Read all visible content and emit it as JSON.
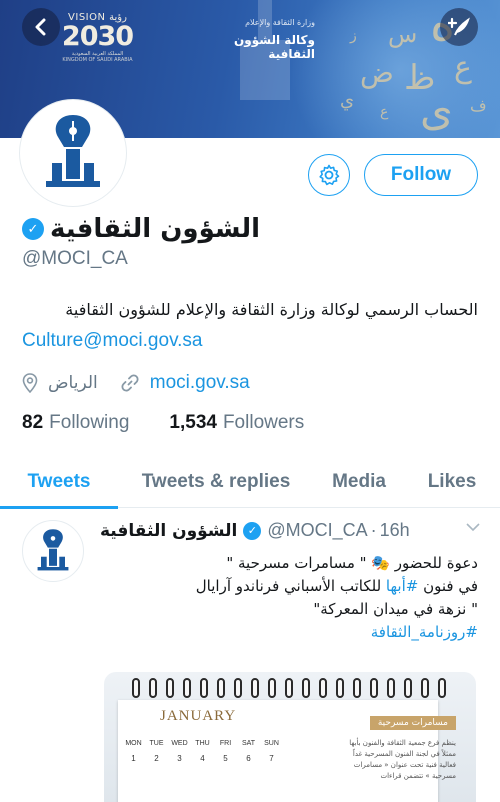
{
  "colors": {
    "accent": "#1da1f2",
    "link": "#1b95e0",
    "muted": "#657786",
    "text": "#14171a"
  },
  "banner": {
    "vision_top": "VISION رؤية",
    "vision_year": "2030",
    "vision_country_ar": "المملكة العربية السعودية",
    "vision_country_en": "KINGDOM OF SAUDI ARABIA",
    "ministry": "وزارة الثقافة والإعلام",
    "agency": "وكالة الشؤون الثقافية",
    "glyphs": [
      "ه",
      "س",
      "ض",
      "ظ",
      "ع",
      "ى",
      "ز",
      "ف",
      "ع",
      "ي"
    ]
  },
  "icons": {
    "back": "chevron-left-icon",
    "compose": "compose-plus-icon",
    "settings": "gear-icon",
    "location": "location-pin-icon",
    "link": "link-icon",
    "verified": "verified-badge-icon"
  },
  "profile": {
    "follow_label": "Follow",
    "display_name": "الشؤون الثقافية",
    "handle": "@MOCI_CA",
    "bio": "الحساب الرسمي لوكالة وزارة الثقافة والإعلام للشؤون الثقافية",
    "bio_email": "Culture@moci.gov.sa",
    "location": "الرياض",
    "website": "moci.gov.sa",
    "following_count": "82",
    "following_label": "Following",
    "followers_count": "1,534",
    "followers_label": "Followers"
  },
  "tabs": [
    {
      "label": "Tweets",
      "active": true
    },
    {
      "label": "Tweets & replies",
      "active": false
    },
    {
      "label": "Media",
      "active": false
    },
    {
      "label": "Likes",
      "active": false
    }
  ],
  "tweet": {
    "name": "الشؤون الثقافية",
    "handle": "@MOCI_CA",
    "separator": "·",
    "time": "16h",
    "line1": "دعوة للحضور 🎭 \" مسامرات مسرحية \"",
    "line2_pre": "في فنون ",
    "line2_tag": "#أبها",
    "line2_post": " للكاتب الأسباني فرناندو آرايال",
    "line3": "\" نزهة في ميدان المعركة\"",
    "line4_tag": "#روزنامة_الثقافة",
    "image": {
      "month": "JANUARY",
      "days": [
        "MON",
        "TUE",
        "WED",
        "THU",
        "FRI",
        "SAT",
        "SUN"
      ],
      "nums": [
        "1",
        "2",
        "3",
        "4",
        "5",
        "6",
        "7"
      ],
      "tag": "مسامرات مسرحية",
      "text": "ينظم فرع جمعية الثقافة والفنون بأبها ممثلاً في لجنة الفنون المسرحية غداً فعالية فنية تحت عنوان « مسامرات مسرحية » تتضمن قراءات"
    }
  }
}
